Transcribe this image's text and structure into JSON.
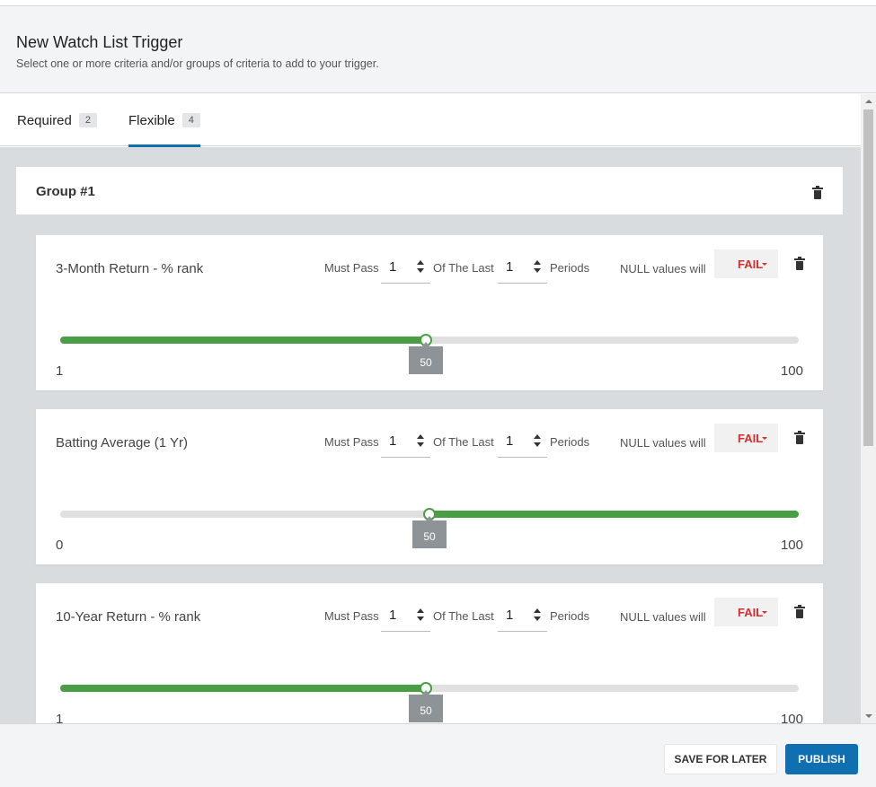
{
  "header": {
    "title": "New Watch List Trigger",
    "subtitle": "Select one or more criteria and/or groups of criteria to add to your trigger."
  },
  "tabs": [
    {
      "label": "Required",
      "count": "2",
      "active": false
    },
    {
      "label": "Flexible",
      "count": "4",
      "active": true
    }
  ],
  "group": {
    "title": "Group #1",
    "criteria": [
      {
        "name": "3-Month Return - % rank",
        "must_pass_label": "Must Pass",
        "must_pass": "1",
        "of_last_label": "Of The Last",
        "of_last": "1",
        "periods_label": "Periods",
        "null_label": "NULL values will",
        "null_action": "FAIL",
        "min": "1",
        "max": "100",
        "value": "50",
        "value_fraction": 0.495,
        "fill": "left"
      },
      {
        "name": "Batting Average (1 Yr)",
        "must_pass_label": "Must Pass",
        "must_pass": "1",
        "of_last_label": "Of The Last",
        "of_last": "1",
        "periods_label": "Periods",
        "null_label": "NULL values will",
        "null_action": "FAIL",
        "min": "0",
        "max": "100",
        "value": "50",
        "value_fraction": 0.5,
        "fill": "right"
      },
      {
        "name": "10-Year Return - % rank",
        "must_pass_label": "Must Pass",
        "must_pass": "1",
        "of_last_label": "Of The Last",
        "of_last": "1",
        "periods_label": "Periods",
        "null_label": "NULL values will",
        "null_action": "FAIL",
        "min": "1",
        "max": "100",
        "value": "50",
        "value_fraction": 0.495,
        "fill": "left"
      }
    ]
  },
  "footer": {
    "save_label": "SAVE FOR LATER",
    "publish_label": "PUBLISH"
  },
  "colors": {
    "accent": "#0f6fb0",
    "slider_fill": "#4a9f46",
    "fail": "#d32f2f"
  }
}
